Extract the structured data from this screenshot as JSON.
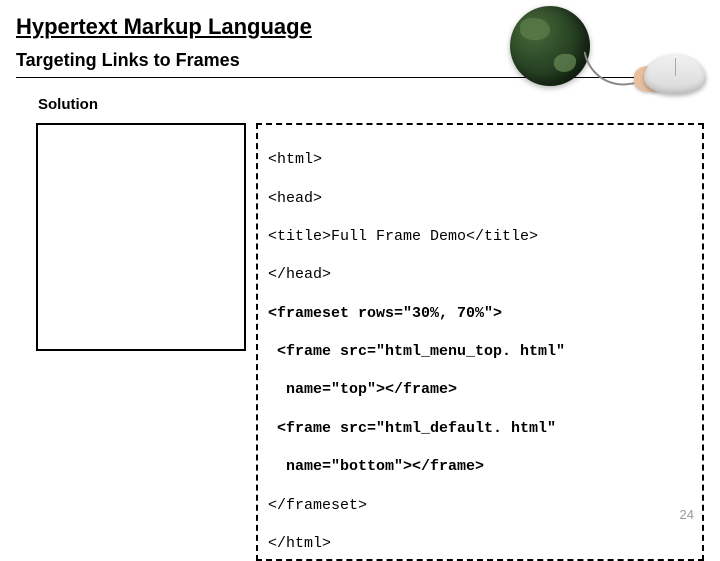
{
  "header": {
    "title": "Hypertext Markup Language",
    "subtitle": "Targeting Links to Frames"
  },
  "solution_label": "Solution",
  "code": {
    "l1": "<html>",
    "l2": "<head>",
    "l3": "<title>Full Frame Demo</title>",
    "l4": "</head>",
    "l5": "<frameset rows=\"30%, 70%\">",
    "l6": " <frame src=\"html_menu_top. html\"",
    "l7": "  name=\"top\"></frame>",
    "l8": " <frame src=\"html_default. html\"",
    "l9": "  name=\"bottom\"></frame>",
    "l10": "</frameset>",
    "l11": "</html>"
  },
  "page_number": "24"
}
